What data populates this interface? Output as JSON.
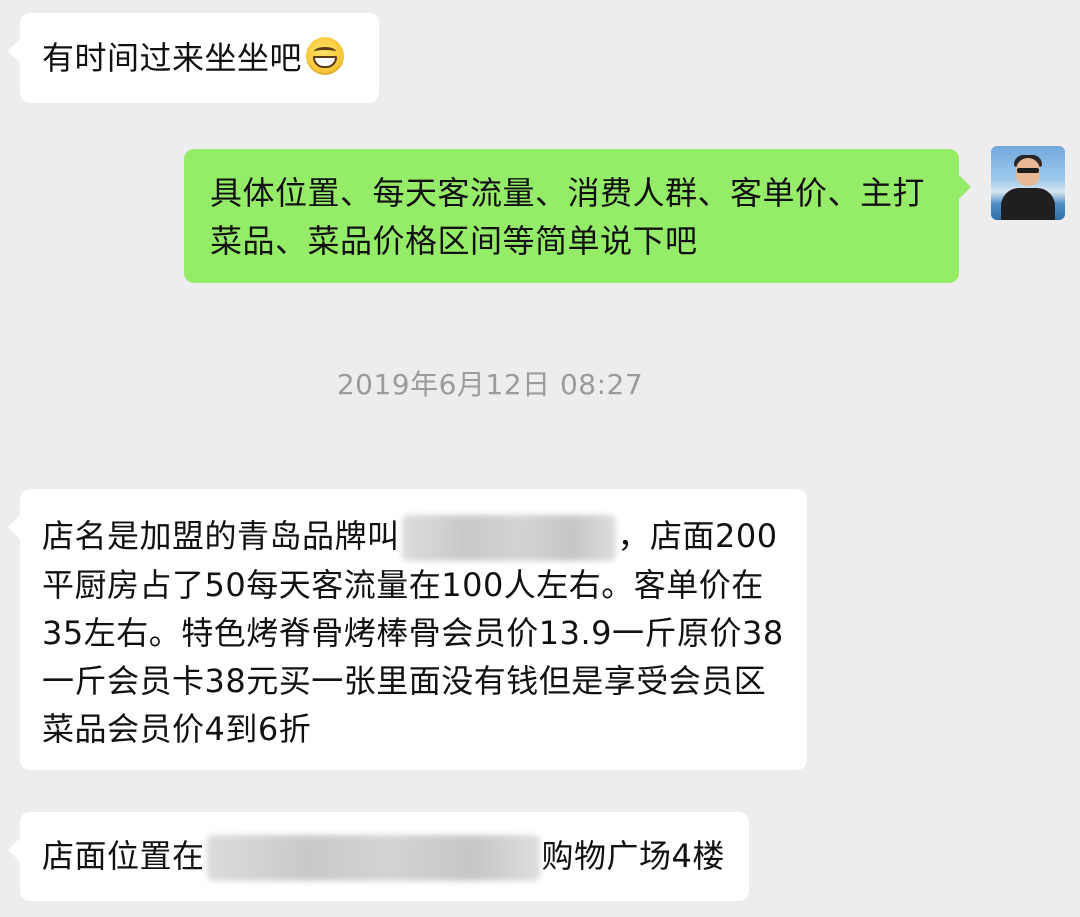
{
  "messages": [
    {
      "side": "in",
      "text": "有时间过来坐坐吧",
      "emoji": "grinning-face-emoji"
    },
    {
      "side": "out",
      "lines": [
        "具体位置、每天客流量、消费人群、客单价、主打",
        "菜品、菜品价格区间等简单说下吧"
      ]
    },
    {
      "timestamp": "2019年6月12日 08:27"
    },
    {
      "side": "in",
      "line1_before": "店名是加盟的青岛品牌叫",
      "line1_after": "，店面200",
      "lines": [
        "平厨房占了50每天客流量在100人左右。客单价在",
        "35左右。特色烤脊骨烤棒骨会员价13.9一斤原价38",
        "一斤会员卡38元买一张里面没有钱但是享受会员区",
        "菜品会员价4到6折"
      ]
    },
    {
      "side": "in",
      "before": "店面位置在",
      "after": "购物广场4楼"
    }
  ],
  "colors": {
    "background": "#ededed",
    "incoming_bubble": "#ffffff",
    "outgoing_bubble": "#95ec69",
    "timestamp_text": "#9b9b9b"
  },
  "avatar": {
    "icon": "user-avatar-photo"
  }
}
